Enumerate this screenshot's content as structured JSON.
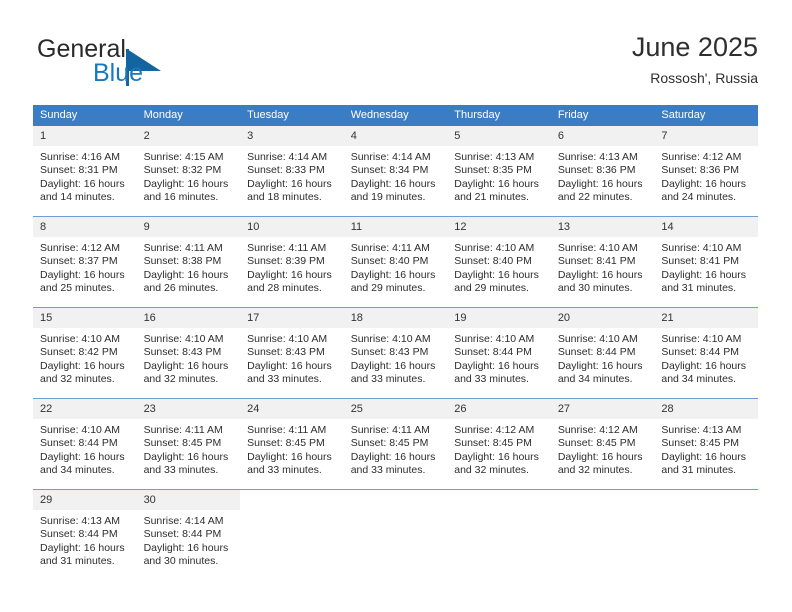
{
  "brand": {
    "word_one": "General",
    "word_two": "Blue",
    "logo_icon": "triangle-flag-icon",
    "color_blue": "#1878be",
    "color_triangle": "#12659f"
  },
  "header": {
    "title": "June 2025",
    "location": "Rossosh', Russia"
  },
  "calendar": {
    "accent_header_color": "#3b7dc4",
    "daynum_background": "#f1f1f1",
    "weekday_headers": [
      "Sunday",
      "Monday",
      "Tuesday",
      "Wednesday",
      "Thursday",
      "Friday",
      "Saturday"
    ],
    "weeks": [
      [
        {
          "day": "1",
          "sunrise": "Sunrise: 4:16 AM",
          "sunset": "Sunset: 8:31 PM",
          "daylight_line1": "Daylight: 16 hours",
          "daylight_line2": "and 14 minutes."
        },
        {
          "day": "2",
          "sunrise": "Sunrise: 4:15 AM",
          "sunset": "Sunset: 8:32 PM",
          "daylight_line1": "Daylight: 16 hours",
          "daylight_line2": "and 16 minutes."
        },
        {
          "day": "3",
          "sunrise": "Sunrise: 4:14 AM",
          "sunset": "Sunset: 8:33 PM",
          "daylight_line1": "Daylight: 16 hours",
          "daylight_line2": "and 18 minutes."
        },
        {
          "day": "4",
          "sunrise": "Sunrise: 4:14 AM",
          "sunset": "Sunset: 8:34 PM",
          "daylight_line1": "Daylight: 16 hours",
          "daylight_line2": "and 19 minutes."
        },
        {
          "day": "5",
          "sunrise": "Sunrise: 4:13 AM",
          "sunset": "Sunset: 8:35 PM",
          "daylight_line1": "Daylight: 16 hours",
          "daylight_line2": "and 21 minutes."
        },
        {
          "day": "6",
          "sunrise": "Sunrise: 4:13 AM",
          "sunset": "Sunset: 8:36 PM",
          "daylight_line1": "Daylight: 16 hours",
          "daylight_line2": "and 22 minutes."
        },
        {
          "day": "7",
          "sunrise": "Sunrise: 4:12 AM",
          "sunset": "Sunset: 8:36 PM",
          "daylight_line1": "Daylight: 16 hours",
          "daylight_line2": "and 24 minutes."
        }
      ],
      [
        {
          "day": "8",
          "sunrise": "Sunrise: 4:12 AM",
          "sunset": "Sunset: 8:37 PM",
          "daylight_line1": "Daylight: 16 hours",
          "daylight_line2": "and 25 minutes."
        },
        {
          "day": "9",
          "sunrise": "Sunrise: 4:11 AM",
          "sunset": "Sunset: 8:38 PM",
          "daylight_line1": "Daylight: 16 hours",
          "daylight_line2": "and 26 minutes."
        },
        {
          "day": "10",
          "sunrise": "Sunrise: 4:11 AM",
          "sunset": "Sunset: 8:39 PM",
          "daylight_line1": "Daylight: 16 hours",
          "daylight_line2": "and 28 minutes."
        },
        {
          "day": "11",
          "sunrise": "Sunrise: 4:11 AM",
          "sunset": "Sunset: 8:40 PM",
          "daylight_line1": "Daylight: 16 hours",
          "daylight_line2": "and 29 minutes."
        },
        {
          "day": "12",
          "sunrise": "Sunrise: 4:10 AM",
          "sunset": "Sunset: 8:40 PM",
          "daylight_line1": "Daylight: 16 hours",
          "daylight_line2": "and 29 minutes."
        },
        {
          "day": "13",
          "sunrise": "Sunrise: 4:10 AM",
          "sunset": "Sunset: 8:41 PM",
          "daylight_line1": "Daylight: 16 hours",
          "daylight_line2": "and 30 minutes."
        },
        {
          "day": "14",
          "sunrise": "Sunrise: 4:10 AM",
          "sunset": "Sunset: 8:41 PM",
          "daylight_line1": "Daylight: 16 hours",
          "daylight_line2": "and 31 minutes."
        }
      ],
      [
        {
          "day": "15",
          "sunrise": "Sunrise: 4:10 AM",
          "sunset": "Sunset: 8:42 PM",
          "daylight_line1": "Daylight: 16 hours",
          "daylight_line2": "and 32 minutes."
        },
        {
          "day": "16",
          "sunrise": "Sunrise: 4:10 AM",
          "sunset": "Sunset: 8:43 PM",
          "daylight_line1": "Daylight: 16 hours",
          "daylight_line2": "and 32 minutes."
        },
        {
          "day": "17",
          "sunrise": "Sunrise: 4:10 AM",
          "sunset": "Sunset: 8:43 PM",
          "daylight_line1": "Daylight: 16 hours",
          "daylight_line2": "and 33 minutes."
        },
        {
          "day": "18",
          "sunrise": "Sunrise: 4:10 AM",
          "sunset": "Sunset: 8:43 PM",
          "daylight_line1": "Daylight: 16 hours",
          "daylight_line2": "and 33 minutes."
        },
        {
          "day": "19",
          "sunrise": "Sunrise: 4:10 AM",
          "sunset": "Sunset: 8:44 PM",
          "daylight_line1": "Daylight: 16 hours",
          "daylight_line2": "and 33 minutes."
        },
        {
          "day": "20",
          "sunrise": "Sunrise: 4:10 AM",
          "sunset": "Sunset: 8:44 PM",
          "daylight_line1": "Daylight: 16 hours",
          "daylight_line2": "and 34 minutes."
        },
        {
          "day": "21",
          "sunrise": "Sunrise: 4:10 AM",
          "sunset": "Sunset: 8:44 PM",
          "daylight_line1": "Daylight: 16 hours",
          "daylight_line2": "and 34 minutes."
        }
      ],
      [
        {
          "day": "22",
          "sunrise": "Sunrise: 4:10 AM",
          "sunset": "Sunset: 8:44 PM",
          "daylight_line1": "Daylight: 16 hours",
          "daylight_line2": "and 34 minutes."
        },
        {
          "day": "23",
          "sunrise": "Sunrise: 4:11 AM",
          "sunset": "Sunset: 8:45 PM",
          "daylight_line1": "Daylight: 16 hours",
          "daylight_line2": "and 33 minutes."
        },
        {
          "day": "24",
          "sunrise": "Sunrise: 4:11 AM",
          "sunset": "Sunset: 8:45 PM",
          "daylight_line1": "Daylight: 16 hours",
          "daylight_line2": "and 33 minutes."
        },
        {
          "day": "25",
          "sunrise": "Sunrise: 4:11 AM",
          "sunset": "Sunset: 8:45 PM",
          "daylight_line1": "Daylight: 16 hours",
          "daylight_line2": "and 33 minutes."
        },
        {
          "day": "26",
          "sunrise": "Sunrise: 4:12 AM",
          "sunset": "Sunset: 8:45 PM",
          "daylight_line1": "Daylight: 16 hours",
          "daylight_line2": "and 32 minutes."
        },
        {
          "day": "27",
          "sunrise": "Sunrise: 4:12 AM",
          "sunset": "Sunset: 8:45 PM",
          "daylight_line1": "Daylight: 16 hours",
          "daylight_line2": "and 32 minutes."
        },
        {
          "day": "28",
          "sunrise": "Sunrise: 4:13 AM",
          "sunset": "Sunset: 8:45 PM",
          "daylight_line1": "Daylight: 16 hours",
          "daylight_line2": "and 31 minutes."
        }
      ],
      [
        {
          "day": "29",
          "sunrise": "Sunrise: 4:13 AM",
          "sunset": "Sunset: 8:44 PM",
          "daylight_line1": "Daylight: 16 hours",
          "daylight_line2": "and 31 minutes."
        },
        {
          "day": "30",
          "sunrise": "Sunrise: 4:14 AM",
          "sunset": "Sunset: 8:44 PM",
          "daylight_line1": "Daylight: 16 hours",
          "daylight_line2": "and 30 minutes."
        },
        {
          "day": "",
          "sunrise": "",
          "sunset": "",
          "daylight_line1": "",
          "daylight_line2": ""
        },
        {
          "day": "",
          "sunrise": "",
          "sunset": "",
          "daylight_line1": "",
          "daylight_line2": ""
        },
        {
          "day": "",
          "sunrise": "",
          "sunset": "",
          "daylight_line1": "",
          "daylight_line2": ""
        },
        {
          "day": "",
          "sunrise": "",
          "sunset": "",
          "daylight_line1": "",
          "daylight_line2": ""
        },
        {
          "day": "",
          "sunrise": "",
          "sunset": "",
          "daylight_line1": "",
          "daylight_line2": ""
        }
      ]
    ]
  }
}
